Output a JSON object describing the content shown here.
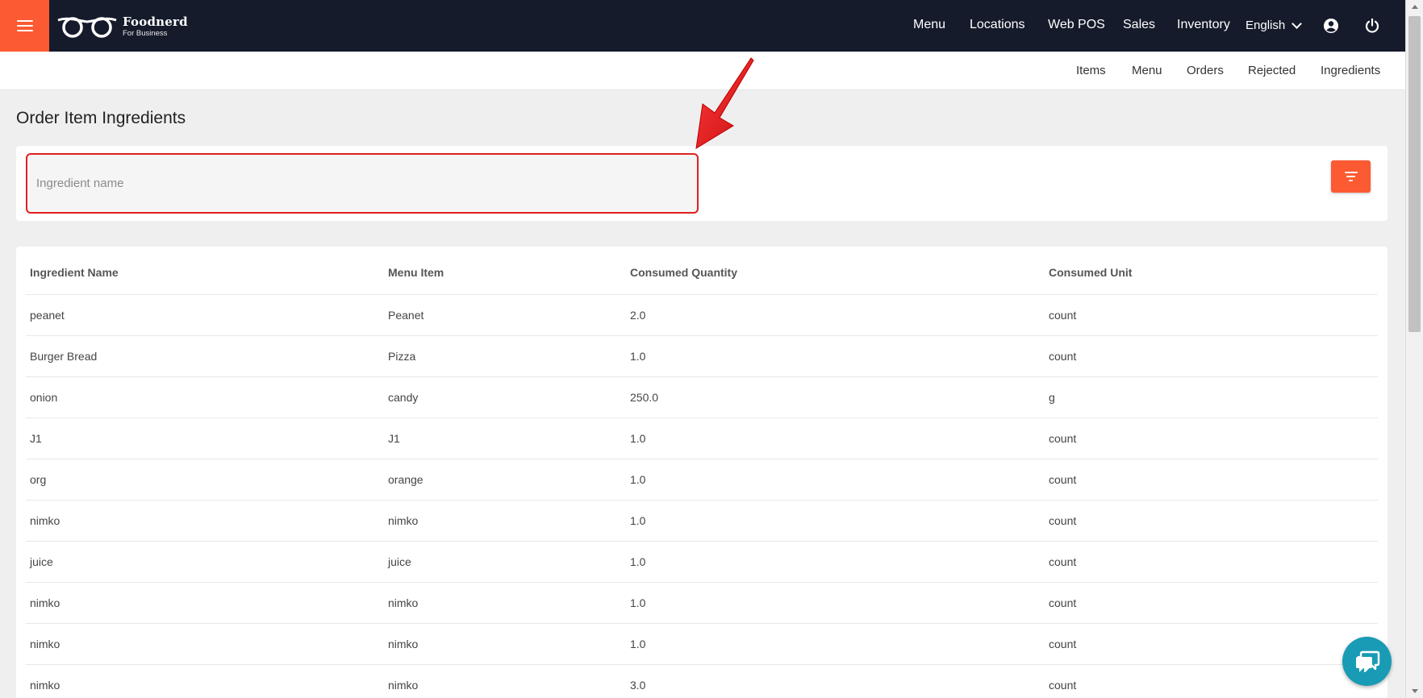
{
  "brand": {
    "name": "Foodnerd",
    "tagline": "For Business"
  },
  "topnav": {
    "items": [
      "Menu",
      "Locations",
      "Web POS",
      "Sales",
      "Inventory"
    ],
    "language": "English",
    "icons": [
      "menu-icon",
      "user-icon",
      "power-icon"
    ]
  },
  "subnav": {
    "items": [
      "Items",
      "Menu",
      "Orders",
      "Rejected",
      "Ingredients"
    ]
  },
  "page": {
    "title": "Order Item Ingredients"
  },
  "filter": {
    "placeholder": "Ingredient name",
    "value": ""
  },
  "table": {
    "headers": [
      "Ingredient Name",
      "Menu Item",
      "Consumed Quantity",
      "Consumed Unit"
    ],
    "rows": [
      [
        "peanet",
        "Peanet",
        "2.0",
        "count"
      ],
      [
        "Burger Bread",
        "Pizza",
        "1.0",
        "count"
      ],
      [
        "onion",
        "candy",
        "250.0",
        "g"
      ],
      [
        "J1",
        "J1",
        "1.0",
        "count"
      ],
      [
        "org",
        "orange",
        "1.0",
        "count"
      ],
      [
        "nimko",
        "nimko",
        "1.0",
        "count"
      ],
      [
        "juice",
        "juice",
        "1.0",
        "count"
      ],
      [
        "nimko",
        "nimko",
        "1.0",
        "count"
      ],
      [
        "nimko",
        "nimko",
        "1.0",
        "count"
      ],
      [
        "nimko",
        "nimko",
        "3.0",
        "count"
      ]
    ]
  },
  "colors": {
    "navbar": "#151b2b",
    "accent": "#fb5a32",
    "annotation": "#e02020",
    "chat": "#1a9bb5"
  }
}
